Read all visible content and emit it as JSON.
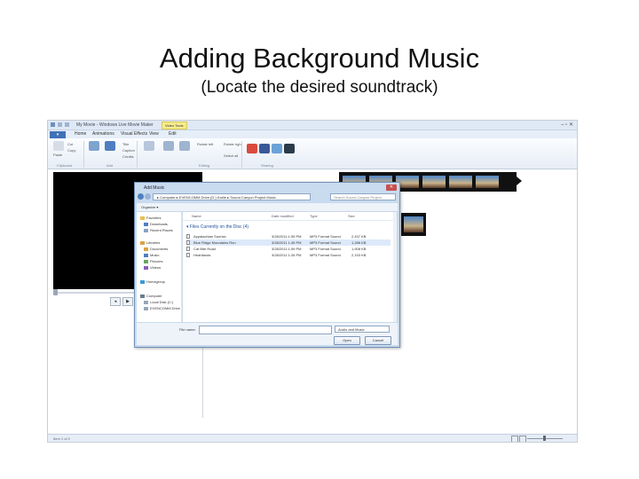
{
  "slide": {
    "title": "Adding Background Music",
    "subtitle": "(Locate the desired soundtrack)"
  },
  "window": {
    "title": "My Movie - Windows Live Movie Maker",
    "video_tools_badge": "Video Tools",
    "controls": "–  ▫  ✕"
  },
  "ribbon": {
    "file_tab": "▾",
    "tabs": [
      "Home",
      "Animations",
      "Visual Effects",
      "View",
      "Edit"
    ],
    "home_buttons": [
      "Paste",
      "Cut",
      "Copy",
      "Add videos and photos",
      "Add music",
      "Title",
      "Caption",
      "Credits",
      "AutoMovie",
      "Snapshot",
      "Webcam video",
      "Rotate left",
      "Rotate right",
      "Select all"
    ],
    "groups": [
      "Clipboard",
      "Add",
      "Editing",
      "Sharing"
    ]
  },
  "dialog": {
    "title": "Add Music",
    "close": "✕",
    "address": "▸ Computer ▸ EVENCOMM Drive (D:) Karlie ▸ Sound Canyon Project Music",
    "search_placeholder": "Search Sound Canyon Project",
    "organize": "Organize ▾",
    "nav": [
      {
        "label": "Favorites",
        "color": "#e9c04b"
      },
      {
        "label": "Downloads",
        "color": "#4f7fc0"
      },
      {
        "label": "Recent Places",
        "color": "#8aa2c2"
      },
      {
        "label": "Libraries",
        "color": "#d9a540"
      },
      {
        "label": "Documents",
        "color": "#d9a540"
      },
      {
        "label": "Music",
        "color": "#4f7fc0"
      },
      {
        "label": "Pictures",
        "color": "#6ca55b"
      },
      {
        "label": "Videos",
        "color": "#8a5fb5"
      },
      {
        "label": "Homegroup",
        "color": "#3d9ad1"
      },
      {
        "label": "Computer",
        "color": "#6a7b92"
      },
      {
        "label": "Local Disk (C:)",
        "color": "#99a6b8"
      },
      {
        "label": "EVENCOMM Drive",
        "color": "#99a6b8"
      }
    ],
    "columns": [
      "Name",
      "Date modified",
      "Type",
      "Size"
    ],
    "group_label": "▾ Files Currently on the Disc (4)",
    "files": [
      {
        "name": "Appalachian Sunrise",
        "date": "3/28/2011 1:59 PM",
        "type": "MP3 Format Sound",
        "size": "2,437 KB"
      },
      {
        "name": "Blue Ridge Mountains Run",
        "date": "3/28/2011 1:45 PM",
        "type": "MP3 Format Sound",
        "size": "1,286 KB"
      },
      {
        "name": "Cat Bite Road",
        "date": "3/28/2011 1:59 PM",
        "type": "MP3 Format Sound",
        "size": "1,908 KB"
      },
      {
        "name": "Heartlands",
        "date": "3/28/2011 1:26 PM",
        "type": "MP3 Format Sound",
        "size": "2,153 KB"
      }
    ],
    "filename_label": "File name:",
    "filter": "Audio and Music",
    "open": "Open",
    "cancel": "Cancel"
  },
  "player": {
    "prev": "◂",
    "play": "▶",
    "next": "▸"
  },
  "statusbar": {
    "text": "Item 1 of 2"
  }
}
